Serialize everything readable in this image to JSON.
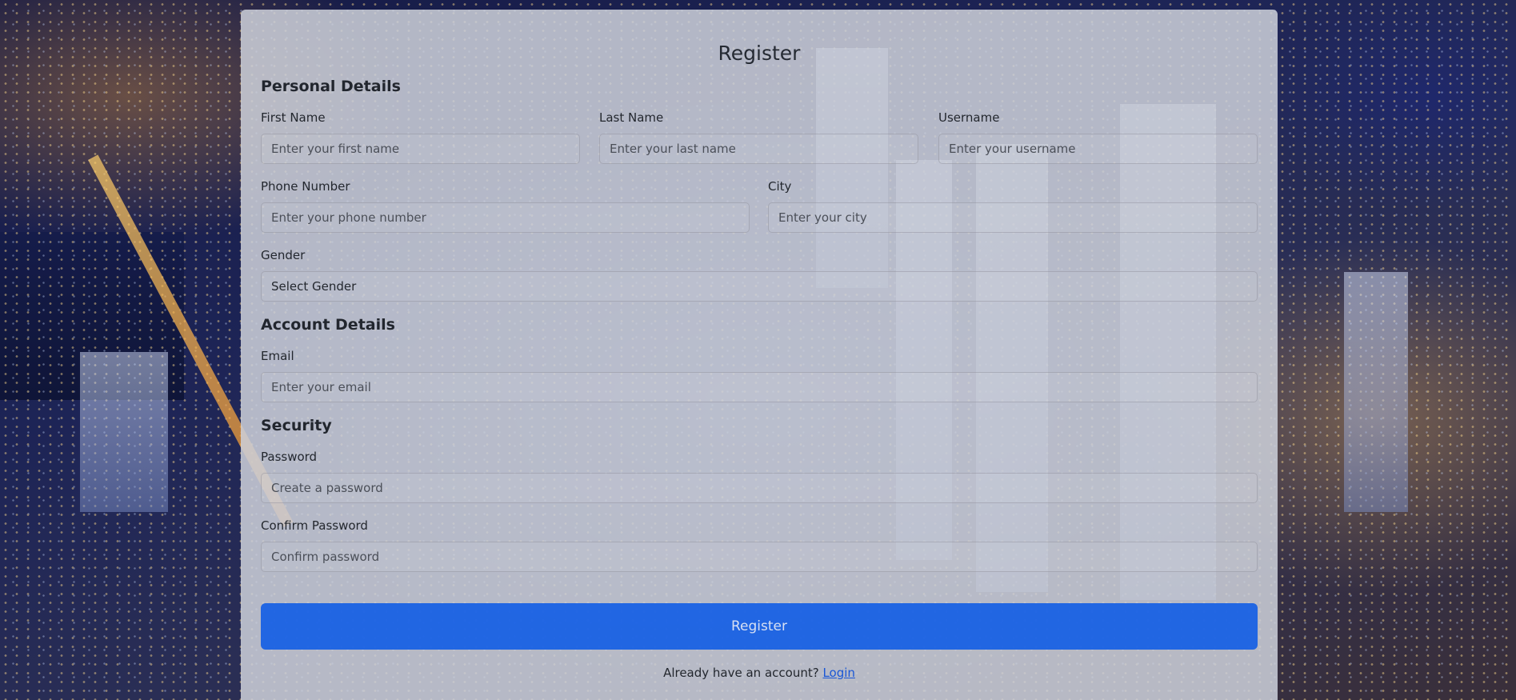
{
  "page": {
    "title": "Register"
  },
  "sections": {
    "personal": "Personal Details",
    "account": "Account Details",
    "security": "Security"
  },
  "fields": {
    "first_name": {
      "label": "First Name",
      "placeholder": "Enter your first name"
    },
    "last_name": {
      "label": "Last Name",
      "placeholder": "Enter your last name"
    },
    "username": {
      "label": "Username",
      "placeholder": "Enter your username"
    },
    "phone": {
      "label": "Phone Number",
      "placeholder": "Enter your phone number"
    },
    "city": {
      "label": "City",
      "placeholder": "Enter your city"
    },
    "gender": {
      "label": "Gender",
      "selected": "Select Gender"
    },
    "email": {
      "label": "Email",
      "placeholder": "Enter your email"
    },
    "password": {
      "label": "Password",
      "placeholder": "Create a password"
    },
    "confirm_password": {
      "label": "Confirm Password",
      "placeholder": "Confirm password"
    }
  },
  "actions": {
    "register_label": "Register",
    "footer_text": "Already have an account?",
    "login_label": "Login"
  },
  "colors": {
    "accent": "#0d5ae6",
    "link": "#1a57d6",
    "card": "#cdd0da"
  }
}
